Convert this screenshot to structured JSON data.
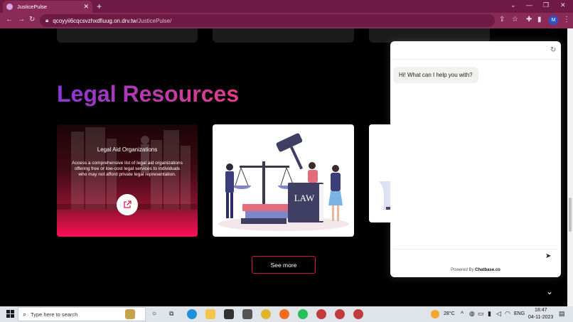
{
  "browser": {
    "tab_title": "JusticePulse",
    "tab_close": "✕",
    "new_tab": "+",
    "url_host": "qcoyyii6cqcsvzhxdfiuug.on.drv.tw",
    "url_path": "/JusticePulse/",
    "profile_initial": "M",
    "window_minimize": "—",
    "window_restore": "❐",
    "window_close": "✕",
    "tab_search": "⌄"
  },
  "page": {
    "section_title": "Legal Resources",
    "card1": {
      "title": "Legal Aid Organizations",
      "description": "Access a comprehensive list of legal aid organizations offering free or low-cost legal services to individuals who may not afford private legal representation."
    },
    "card2": {
      "sign_text": "LAW"
    },
    "see_more_label": "See more",
    "scroll_down_icon": "⌄"
  },
  "chat": {
    "greeting": "Hi! What can I help you with?",
    "input_placeholder": "",
    "powered_prefix": "Powered By ",
    "powered_brand": "Chatbase.co"
  },
  "taskbar": {
    "search_placeholder": "Type here to search",
    "weather": "28°C",
    "language": "ENG",
    "time": "18:47",
    "date": "04-11-2023"
  },
  "colors": {
    "browser_frame": "#6d1b44",
    "browser_toolbar": "#8a2a57",
    "title_gradient_start": "#8b36d6",
    "title_gradient_end": "#e33d86",
    "accent_red": "#d4173f"
  }
}
